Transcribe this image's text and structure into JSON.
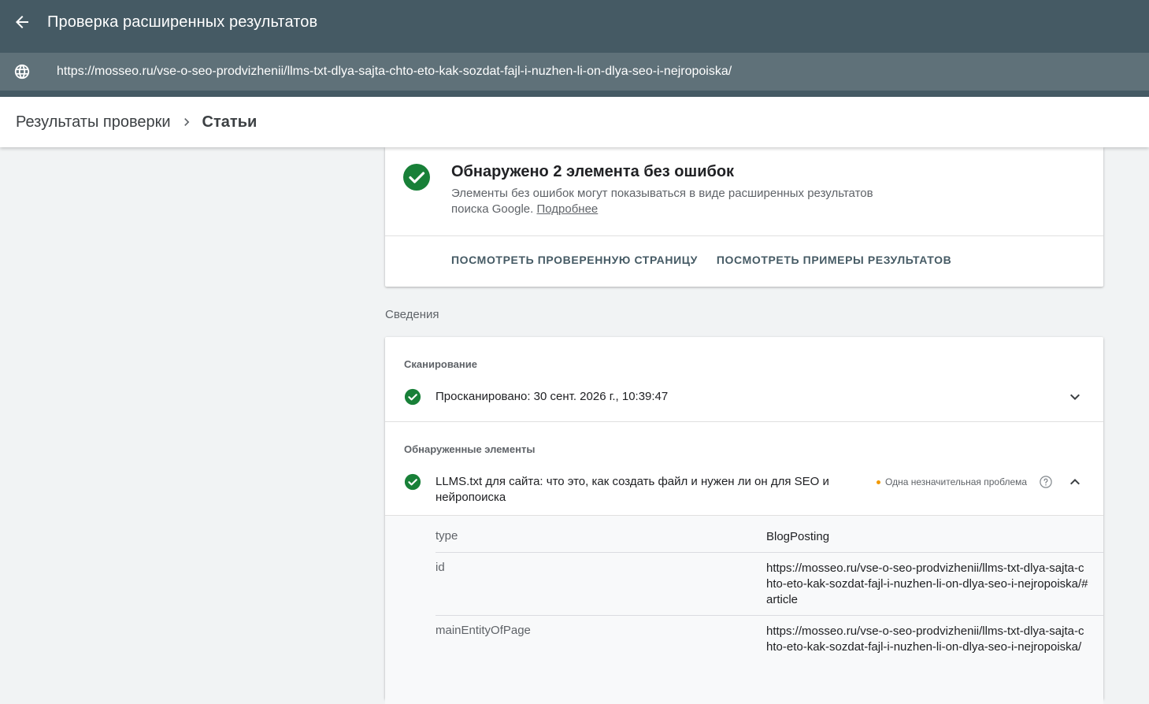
{
  "appbar": {
    "title": "Проверка расширенных результатов",
    "back_icon": "arrow-back-icon"
  },
  "urlbar": {
    "url": "https://mosseo.ru/vse-o-seo-prodvizhenii/llms-txt-dlya-sajta-chto-eto-kak-sozdat-fajl-i-nuzhen-li-on-dlya-seo-i-nejropoiska/",
    "icon": "globe-icon"
  },
  "breadcrumb": {
    "parent": "Результаты проверки",
    "current": "Статьи"
  },
  "summary": {
    "headline": "Обнаружено 2 элемента без ошибок",
    "description": "Элементы без ошибок могут показываться в виде расширенных результатов поиска Google.",
    "learn_more": "Подробнее",
    "actions": [
      "Посмотреть проверенную страницу",
      "Посмотреть примеры результатов"
    ]
  },
  "details": {
    "section_label": "Сведения",
    "crawl": {
      "title": "Сканирование",
      "status": "Просканировано: 30 сент. 2026 г., 10:39:47"
    },
    "detected": {
      "title": "Обнаруженные элементы",
      "item_title": "LLMS.txt для сайта: что это, как создать файл и нужен ли он для SEO и нейропоиска",
      "issue": "Одна незначительная проблема",
      "properties": [
        {
          "key": "type",
          "value": "BlogPosting"
        },
        {
          "key": "id",
          "value": "https://mosseo.ru/vse-o-seo-prodvizhenii/llms-txt-dlya-sajta-chto-eto-kak-sozdat-fajl-i-nuzhen-li-on-dlya-seo-i-nejropoiska/#article"
        },
        {
          "key": "mainEntityOfPage",
          "value": "https://mosseo.ru/vse-o-seo-prodvizhenii/llms-txt-dlya-sajta-chto-eto-kak-sozdat-fajl-i-nuzhen-li-on-dlya-seo-i-nejropoiska/"
        }
      ]
    }
  },
  "colors": {
    "header": "#455a64",
    "url_bar": "#5f7179",
    "success": "#188038",
    "warning": "#f29900"
  }
}
